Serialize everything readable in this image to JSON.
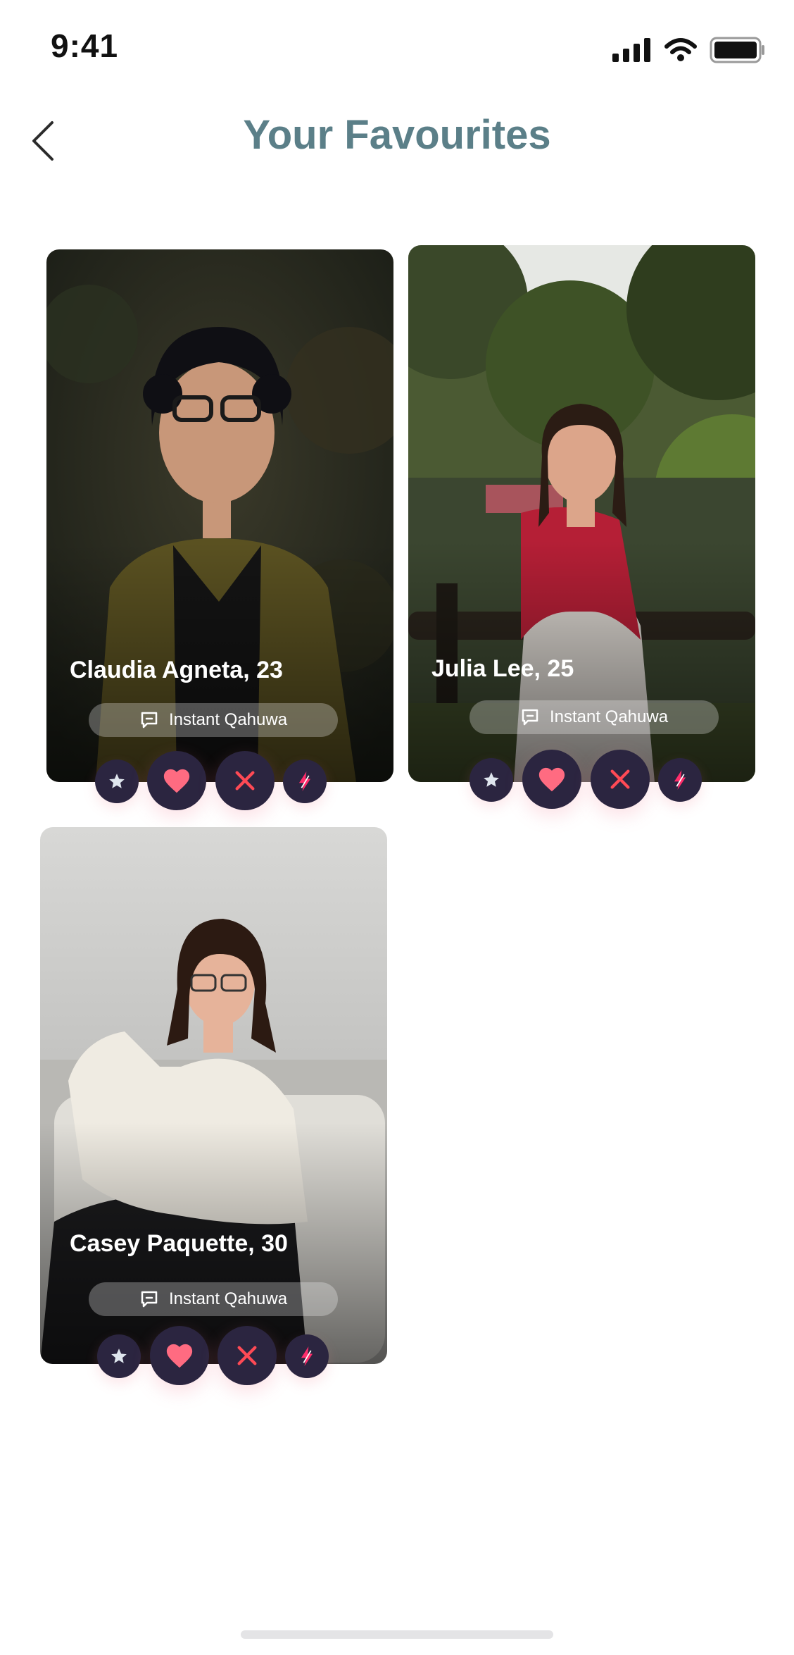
{
  "status_bar": {
    "time": "9:41"
  },
  "header": {
    "title": "Your Favourites"
  },
  "favourites": [
    {
      "name": "Claudia Agneta, 23",
      "chat_label": "Instant Qahuwa"
    },
    {
      "name": "Julia Lee, 25",
      "chat_label": "Instant Qahuwa"
    },
    {
      "name": "Casey Paquette, 30",
      "chat_label": "Instant Qahuwa"
    }
  ],
  "icons": {
    "back": "chevron-left-icon",
    "chat": "chat-bubble-icon",
    "star": "star-icon",
    "heart": "heart-icon",
    "close": "close-icon",
    "boost": "lightning-icon"
  },
  "colors": {
    "title": "#5b7f88",
    "action_bg": "#2b2540",
    "heart": "#ff6b81",
    "close": "#ff4a55",
    "boost": "#ff2d6b"
  }
}
